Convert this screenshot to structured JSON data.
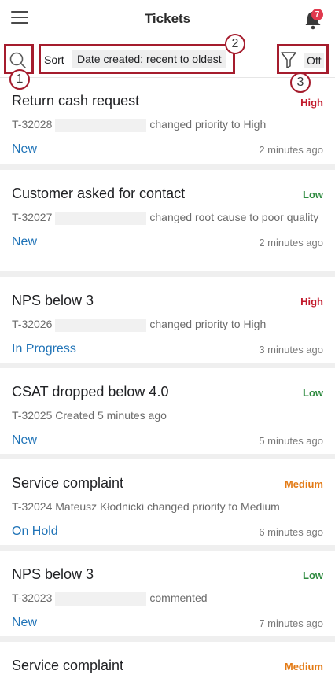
{
  "header": {
    "title": "Tickets",
    "notification_count": "7"
  },
  "toolbar": {
    "sort_label": "Sort",
    "sort_value": "Date created: recent to oldest",
    "filter_state": "Off"
  },
  "annotations": [
    "1",
    "2",
    "3"
  ],
  "tickets": [
    {
      "title": "Return cash request",
      "priority": "High",
      "id": "T-32028",
      "action": "changed priority to High",
      "status": "New",
      "time": "2 minutes ago"
    },
    {
      "title": "Customer asked for contact",
      "priority": "Low",
      "id": "T-32027",
      "action": "changed root cause to poor quality",
      "status": "New",
      "time": "2 minutes ago"
    },
    {
      "title": "NPS below 3",
      "priority": "High",
      "id": "T-32026",
      "action": "changed priority to High",
      "status": "In Progress",
      "time": "3 minutes ago"
    },
    {
      "title": "CSAT dropped below 4.0",
      "priority": "Low",
      "id": "T-32025",
      "action": "Created 5 minutes ago",
      "status": "New",
      "time": "5 minutes ago"
    },
    {
      "title": "Service complaint",
      "priority": "Medium",
      "id": "T-32024",
      "action": "Mateusz Kłodnicki changed priority to Medium",
      "status": "On Hold",
      "time": "6 minutes ago"
    },
    {
      "title": "NPS below 3",
      "priority": "Low",
      "id": "T-32023",
      "action": "commented",
      "status": "New",
      "time": "7 minutes ago"
    },
    {
      "title": "Service complaint",
      "priority": "Medium"
    }
  ],
  "colors": {
    "annotation": "#a51c2d",
    "status_link": "#1f73b7",
    "high": "#c2192b",
    "low": "#2d8a3e",
    "medium": "#e37b16"
  }
}
